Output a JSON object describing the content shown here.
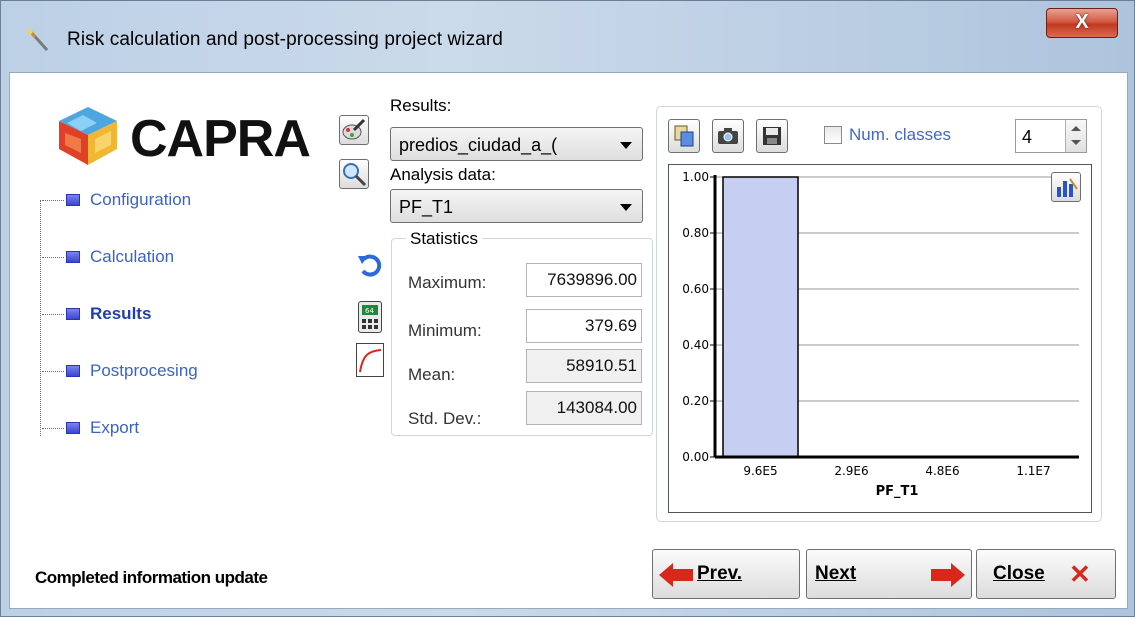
{
  "window": {
    "title": "Risk calculation and post-processing project wizard",
    "close_glyph": "X"
  },
  "logo": {
    "text": "CAPRA"
  },
  "nav": {
    "items": [
      {
        "label": "Configuration"
      },
      {
        "label": "Calculation"
      },
      {
        "label": "Results"
      },
      {
        "label": "Postprocesing"
      },
      {
        "label": "Export"
      }
    ],
    "active_index": 2
  },
  "results": {
    "label": "Results:",
    "selected": "predios_ciudad_a_("
  },
  "analysis": {
    "label": "Analysis data:",
    "selected": "PF_T1"
  },
  "statistics": {
    "title": "Statistics",
    "maximum_label": "Maximum:",
    "maximum_value": "7639896.00",
    "minimum_label": "Minimum:",
    "minimum_value": "379.69",
    "mean_label": "Mean:",
    "mean_value": "58910.51",
    "std_label": "Std. Dev.:",
    "std_value": "143084.00"
  },
  "chart_toolbar": {
    "num_classes_label": "Num. classes",
    "num_classes_checked": false,
    "num_classes_value": "4"
  },
  "chart_data": {
    "type": "bar",
    "categories": [
      "9.6E5",
      "2.9E6",
      "4.8E6",
      "1.1E7"
    ],
    "values": [
      1.0,
      0.0,
      0.0,
      0.0
    ],
    "xlabel": "PF_T1",
    "ylabel": "",
    "ylim": [
      0,
      1
    ],
    "yticks": [
      "0.00",
      "0.20",
      "0.40",
      "0.60",
      "0.80",
      "1.00"
    ],
    "bar_color": "#c6cef2",
    "grid": true
  },
  "status": {
    "text": "Completed information update"
  },
  "buttons": {
    "prev_label": "Prev.",
    "next_label": "Next",
    "close_label": "Close",
    "close_glyph": "✕"
  },
  "colors": {
    "nav_link": "#3a63c8",
    "accent_arrow": "#d8281c"
  }
}
